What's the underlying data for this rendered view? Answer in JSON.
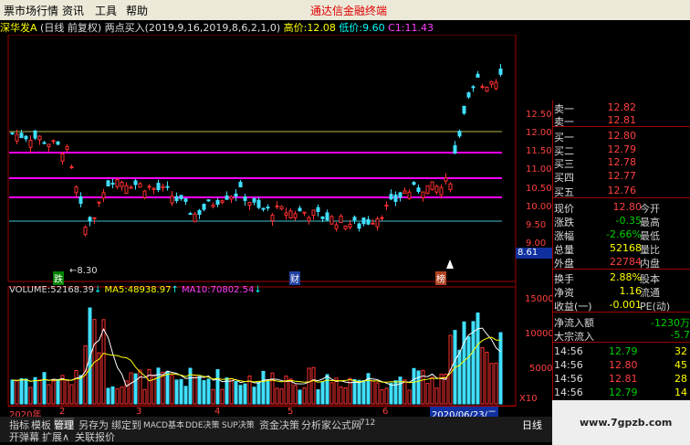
{
  "menu": {
    "items": [
      "票市场行情",
      "资讯",
      "工具",
      "帮助"
    ],
    "promo": "通达信金融终端"
  },
  "title_line": {
    "name": "深华发A",
    "mode": "(日线 前复权)",
    "indicator": "两点买入(2019,9,16,2019,8,6,2,1,0)",
    "high_label": "高价:",
    "high": "12.08",
    "low_label": "低价:",
    "low": "9.60",
    "c1_label": "C1:",
    "c1": "11.43"
  },
  "price_axis": [
    "12.50",
    "12.00",
    "11.50",
    "11.00",
    "10.50",
    "10.00",
    "9.50",
    "9.00"
  ],
  "price_marker": "8.61",
  "annotations": {
    "low_mark": "←8.30",
    "event1": "跌",
    "event2": "财",
    "event3": "榜"
  },
  "volume_header": {
    "label": "VOLUME:",
    "value": "52168.39",
    "ma5_label": "MA5:",
    "ma5": "48938.97",
    "ma10_label": "MA10:",
    "ma10": "70802.54"
  },
  "volume_axis": [
    "15000",
    "10000",
    "5000"
  ],
  "volume_unit": "X10",
  "date_axis": {
    "start": "2020年",
    "marks": [
      "2",
      "3",
      "4",
      "5",
      "6"
    ],
    "cursor_date": "2020/06/23/二"
  },
  "quote": {
    "ask": [
      {
        "label": "卖一",
        "price": "12.82"
      },
      {
        "label": "卖一",
        "price": "12.81"
      }
    ],
    "bid": [
      {
        "label": "买一",
        "price": "12.80"
      },
      {
        "label": "买二",
        "price": "12.79"
      },
      {
        "label": "买三",
        "price": "12.78"
      },
      {
        "label": "买四",
        "price": "12.77"
      },
      {
        "label": "买五",
        "price": "12.76"
      }
    ],
    "stats": [
      {
        "l1": "现价",
        "v1": "12.80",
        "l2": "今开"
      },
      {
        "l1": "涨跌",
        "v1": "-0.35",
        "l2": "最高"
      },
      {
        "l1": "涨幅",
        "v1": "-2.66%",
        "l2": "最低"
      },
      {
        "l1": "总量",
        "v1": "52168",
        "l2": "量比"
      },
      {
        "l1": "外盘",
        "v1": "22784",
        "l2": "内盘"
      }
    ],
    "extra": [
      {
        "l1": "换手",
        "v1": "2.88%",
        "l2": "股本"
      },
      {
        "l1": "净资",
        "v1": "1.16",
        "l2": "流通"
      },
      {
        "l1": "收益(一)",
        "v1": "-0.001",
        "l2": "PE(动)"
      }
    ],
    "flow": [
      {
        "label": "净流入额",
        "value": "-1230万"
      },
      {
        "label": "大宗流入",
        "value": "-5.7"
      }
    ],
    "ticks": [
      {
        "time": "14:56",
        "price": "12.79",
        "vol": "32"
      },
      {
        "time": "14:56",
        "price": "12.80",
        "vol": "45"
      },
      {
        "time": "14:56",
        "price": "12.81",
        "vol": "28"
      },
      {
        "time": "14:56",
        "price": "12.79",
        "vol": "14"
      }
    ]
  },
  "bottom_tabs": [
    "指标",
    "模板",
    "管理",
    "另存为",
    "绑定到",
    "MACD基本",
    "DDE决策",
    "SUP决策",
    "资金决策",
    "分析家公式网",
    "712"
  ],
  "bottom_tabs2": [
    "开弹幕",
    "扩展∧",
    "关联报价"
  ],
  "right_tab": "日线",
  "watermark": "www.7gpzb.com"
}
